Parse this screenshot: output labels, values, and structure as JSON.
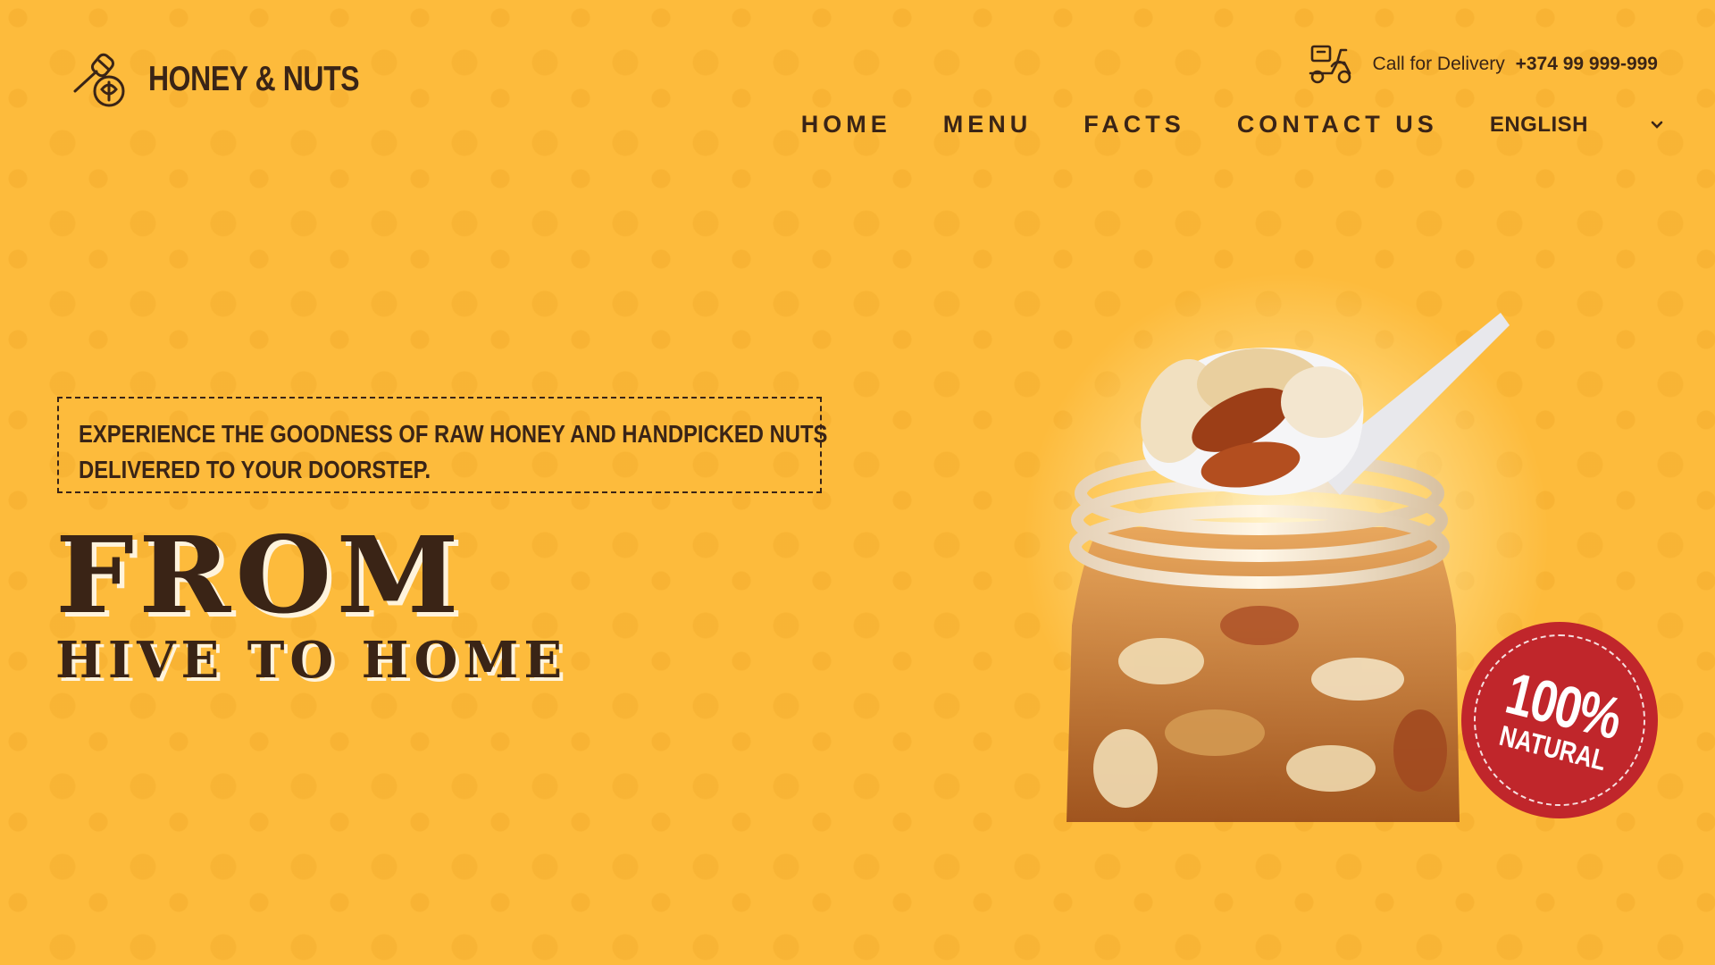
{
  "brand": {
    "name": "HONEY & NUTS",
    "logo_icon": "honey-dipper-nut-icon"
  },
  "header": {
    "delivery_icon": "delivery-scooter-icon",
    "delivery_label": "Call for Delivery",
    "delivery_phone": "+374 99 999-999"
  },
  "nav": {
    "items": [
      {
        "label": "HOME"
      },
      {
        "label": "MENU"
      },
      {
        "label": "FACTS"
      },
      {
        "label": "CONTACT US"
      }
    ],
    "language": {
      "selected": "ENGLISH",
      "icon": "chevron-down-icon"
    }
  },
  "hero": {
    "tagline": "EXPERIENCE THE GOODNESS OF RAW HONEY AND HANDPICKED NUTS DELIVERED TO YOUR DOORSTEP.",
    "title_line1": "FROM",
    "title_line2": "HIVE TO HOME",
    "badge": {
      "percent": "100%",
      "word": "NATURAL"
    }
  },
  "colors": {
    "background": "#fdbb3c",
    "text": "#3a2416",
    "badge": "#c0262b"
  }
}
